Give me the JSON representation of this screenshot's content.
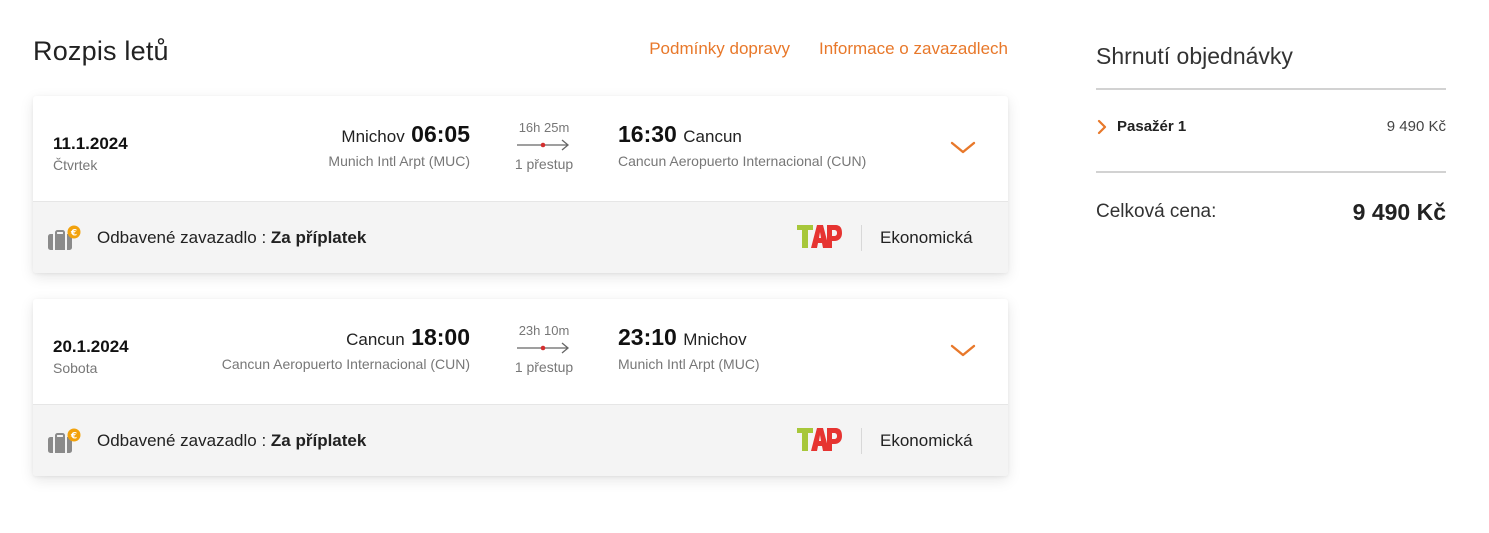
{
  "itinerary": {
    "title": "Rozpis letů",
    "links": [
      "Podmínky dopravy",
      "Informace o zavazadlech"
    ]
  },
  "flights": [
    {
      "date": "11.1.2024",
      "day": "Čtvrtek",
      "dep_city": "Mnichov",
      "dep_time": "06:05",
      "dep_airport": "Munich Intl Arpt (MUC)",
      "duration": "16h 25m",
      "stops": "1 přestup",
      "arr_time": "16:30",
      "arr_city": "Cancun",
      "arr_airport": "Cancun Aeropuerto Internacional (CUN)",
      "baggage_label": "Odbavené zavazadlo : ",
      "baggage_value": "Za příplatek",
      "cabin": "Ekonomická"
    },
    {
      "date": "20.1.2024",
      "day": "Sobota",
      "dep_city": "Cancun",
      "dep_time": "18:00",
      "dep_airport": "Cancun Aeropuerto Internacional (CUN)",
      "duration": "23h 10m",
      "stops": "1 přestup",
      "arr_time": "23:10",
      "arr_city": "Mnichov",
      "arr_airport": "Munich Intl Arpt (MUC)",
      "baggage_label": "Odbavené zavazadlo : ",
      "baggage_value": "Za příplatek",
      "cabin": "Ekonomická"
    }
  ],
  "summary": {
    "title": "Shrnutí objednávky",
    "passenger_label": "Pasažér 1",
    "passenger_price": "9 490 Kč",
    "total_label": "Celková cena:",
    "total_price": "9 490 Kč"
  },
  "colors": {
    "accent": "#e8782a",
    "tap_green": "#a7c73a",
    "tap_red": "#e63431"
  },
  "icons": [
    "chevron-down-icon",
    "route-arrow-icon",
    "paid-baggage-icon",
    "tap-logo",
    "chevron-right-icon"
  ]
}
